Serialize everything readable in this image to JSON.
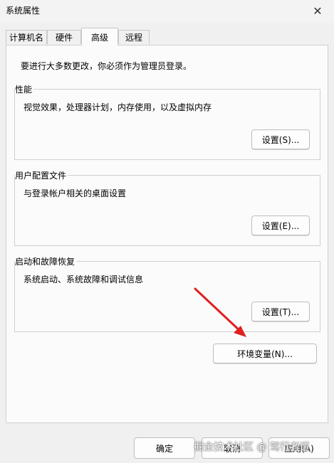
{
  "window": {
    "title": "系统属性",
    "close_glyph": "✕"
  },
  "tabs": [
    {
      "label": "计算机名"
    },
    {
      "label": "硬件"
    },
    {
      "label": "高级"
    },
    {
      "label": "远程"
    }
  ],
  "intro_text": "要进行大多数更改，你必须作为管理员登录。",
  "groups": {
    "performance": {
      "label": "性能",
      "description": "视觉效果，处理器计划，内存使用，以及虚拟内存",
      "button": "设置(S)..."
    },
    "user_profiles": {
      "label": "用户配置文件",
      "description": "与登录帐户相关的桌面设置",
      "button": "设置(E)..."
    },
    "startup_recovery": {
      "label": "启动和故障恢复",
      "description": "系统启动、系统故障和调试信息",
      "button": "设置(T)..."
    }
  },
  "env_button": "环境变量(N)...",
  "footer": {
    "ok": "确定",
    "cancel": "取消",
    "apply": "应用(A)"
  },
  "watermark": "掘金技术社区 @ 驾行者道",
  "colors": {
    "arrow": "#e02020"
  },
  "icons": {
    "close": "close-icon",
    "annotation": "red-arrow-icon"
  }
}
